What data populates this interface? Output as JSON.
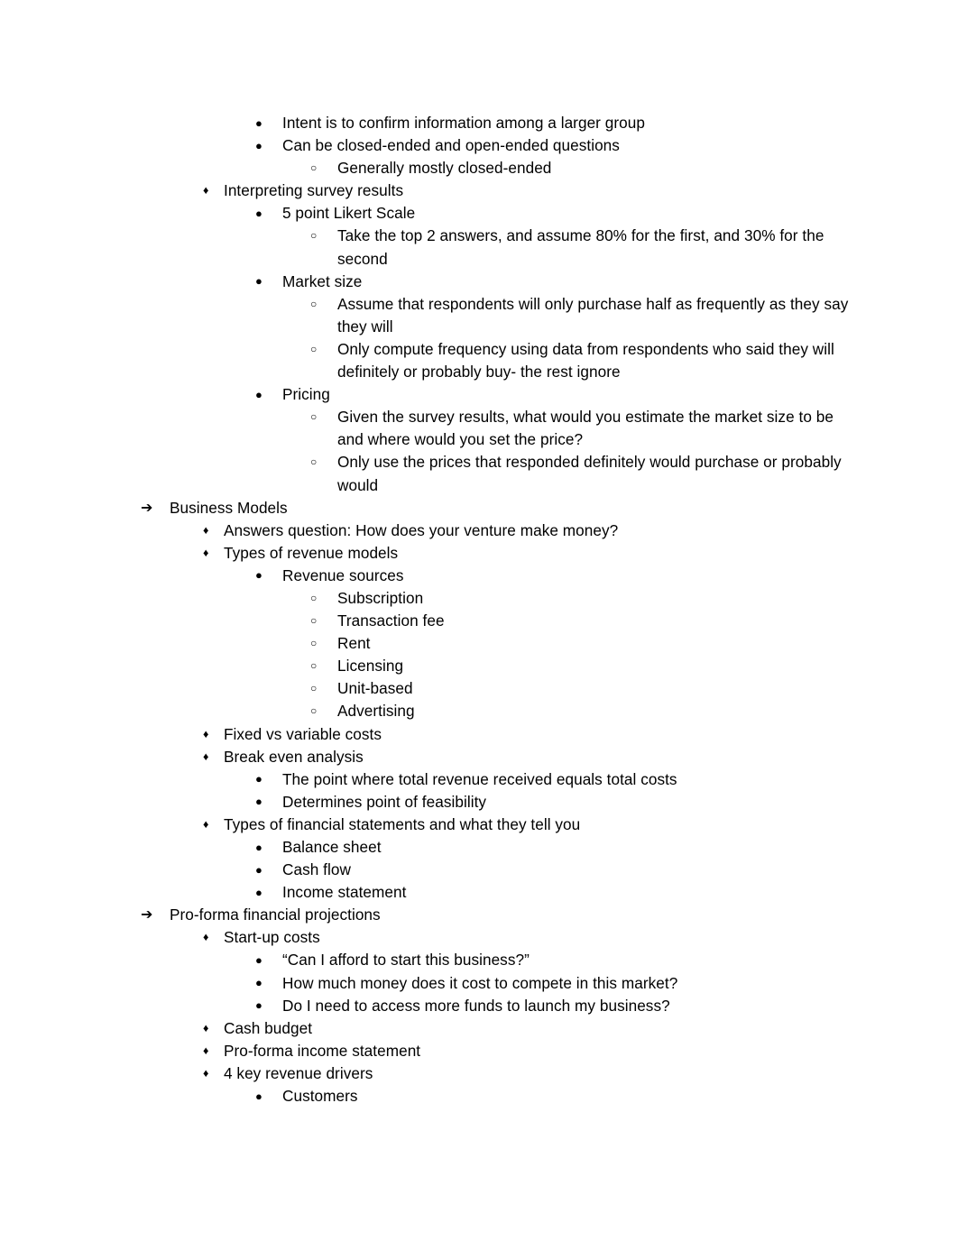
{
  "page": {
    "background_color": "#ffffff",
    "text_color": "#000000",
    "document_type": "outline-notes"
  },
  "markers": {
    "level1": "➔",
    "level2": "♦",
    "level3": "●",
    "level4": "○"
  },
  "outline": [
    {
      "level": 3,
      "text": "Intent is to confirm information among a larger group"
    },
    {
      "level": 3,
      "text": "Can be closed-ended and open-ended questions"
    },
    {
      "level": 4,
      "text": "Generally mostly closed-ended"
    },
    {
      "level": 2,
      "text": "Interpreting survey results"
    },
    {
      "level": 3,
      "text": "5 point Likert Scale"
    },
    {
      "level": 4,
      "text": "Take the top 2 answers, and assume 80% for the first, and 30% for the second"
    },
    {
      "level": 3,
      "text": "Market size"
    },
    {
      "level": 4,
      "text": "Assume that respondents will only purchase half as frequently as they say they will"
    },
    {
      "level": 4,
      "text": "Only compute frequency using data from respondents who said they will definitely or probably buy- the rest ignore"
    },
    {
      "level": 3,
      "text": "Pricing"
    },
    {
      "level": 4,
      "text": "Given the survey results, what would you estimate the market size to be and where would you set the price?"
    },
    {
      "level": 4,
      "text": "Only use the prices that responded definitely would purchase or probably would"
    },
    {
      "level": 1,
      "text": "Business Models"
    },
    {
      "level": 2,
      "text": "Answers question: How does your venture make money?"
    },
    {
      "level": 2,
      "text": "Types of revenue models"
    },
    {
      "level": 3,
      "text": "Revenue sources"
    },
    {
      "level": 4,
      "text": "Subscription"
    },
    {
      "level": 4,
      "text": "Transaction fee"
    },
    {
      "level": 4,
      "text": "Rent"
    },
    {
      "level": 4,
      "text": "Licensing"
    },
    {
      "level": 4,
      "text": "Unit-based"
    },
    {
      "level": 4,
      "text": "Advertising"
    },
    {
      "level": 2,
      "text": "Fixed vs variable costs"
    },
    {
      "level": 2,
      "text": "Break even analysis"
    },
    {
      "level": 3,
      "text": "The point where total revenue received equals total costs"
    },
    {
      "level": 3,
      "text": "Determines point of feasibility"
    },
    {
      "level": 2,
      "text": "Types of financial statements and what they tell you"
    },
    {
      "level": 3,
      "text": "Balance sheet"
    },
    {
      "level": 3,
      "text": "Cash flow"
    },
    {
      "level": 3,
      "text": "Income statement"
    },
    {
      "level": 1,
      "text": "Pro-forma financial projections"
    },
    {
      "level": 2,
      "text": "Start-up costs"
    },
    {
      "level": 3,
      "text": "“Can I afford to start this business?”"
    },
    {
      "level": 3,
      "text": "How much money does it cost to compete in this market?"
    },
    {
      "level": 3,
      "text": "Do I need to access more funds to launch my business?"
    },
    {
      "level": 2,
      "text": "Cash budget"
    },
    {
      "level": 2,
      "text": "Pro-forma income statement"
    },
    {
      "level": 2,
      "text": "4 key revenue drivers"
    },
    {
      "level": 3,
      "text": "Customers"
    }
  ]
}
